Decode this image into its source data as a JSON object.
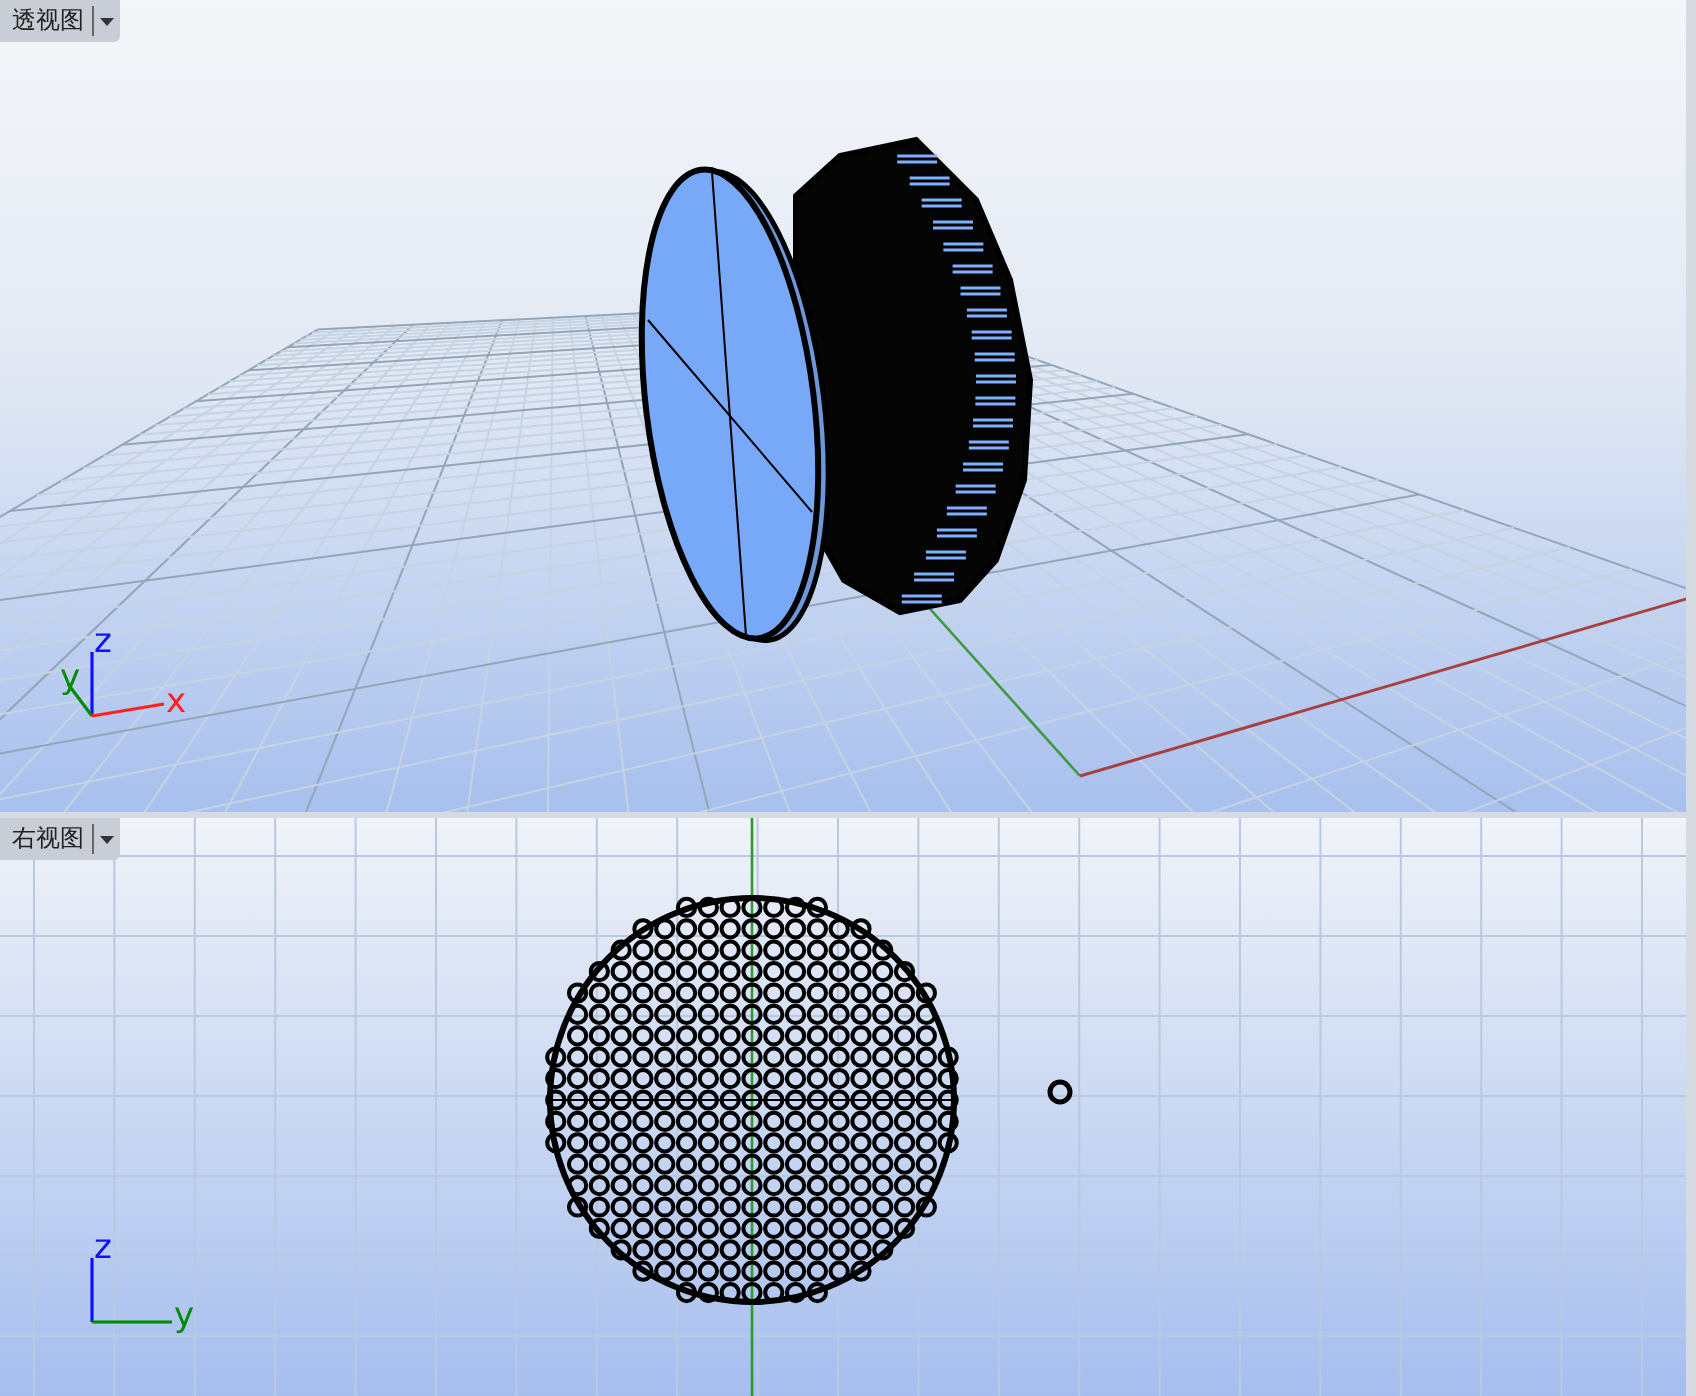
{
  "viewports": [
    {
      "title": "透视图",
      "kind": "perspective",
      "axes": [
        {
          "kind": "z",
          "label": "z"
        },
        {
          "kind": "y",
          "label": "y"
        },
        {
          "kind": "x",
          "label": "x"
        }
      ]
    },
    {
      "title": "右视图",
      "kind": "right",
      "axes": [
        {
          "kind": "z",
          "label": "z"
        },
        {
          "kind": "y",
          "label": "y"
        }
      ]
    }
  ]
}
